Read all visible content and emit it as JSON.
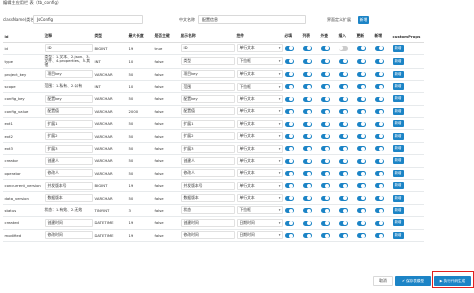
{
  "window": {
    "title": "编辑主应用栏 表（tb_config）"
  },
  "meta": {
    "class_label": "className(类名)",
    "class_value": "JsConfig",
    "cn_label": "中文名称",
    "cn_value": "配置信息",
    "ext_label": "界面定义扩展",
    "ext_button": "新增"
  },
  "table": {
    "headers": [
      "id",
      "注释",
      "类型",
      "最大长度",
      "是否主键",
      "显示名称",
      "控件",
      "必填",
      "列表",
      "外查",
      "插入",
      "更新",
      "新增",
      "customProps"
    ],
    "rows": [
      {
        "field": "id",
        "comment": "ID",
        "type": "BIGINT",
        "len": "19",
        "pk": "true",
        "label": "ID",
        "control": "单行文本",
        "t": [
          1,
          1,
          1,
          0,
          1,
          1
        ],
        "btn": "新增"
      },
      {
        "field": "type",
        "comment": "类型：1.文本、2.json、3.文件、4.properties、5.其他",
        "type": "INT",
        "len": "10",
        "pk": "false",
        "label": "类型",
        "control": "下拉框",
        "t": [
          1,
          1,
          1,
          1,
          1,
          1
        ],
        "btn": "新增"
      },
      {
        "field": "project_key",
        "comment": "项目key",
        "type": "VARCHAR",
        "len": "50",
        "pk": "false",
        "label": "项目key",
        "control": "单行文本",
        "t": [
          1,
          1,
          1,
          1,
          1,
          1
        ],
        "btn": "新增"
      },
      {
        "field": "scope",
        "comment": "范围：1.私有、2.公有",
        "type": "INT",
        "len": "10",
        "pk": "false",
        "label": "范围",
        "control": "下拉框",
        "t": [
          1,
          1,
          1,
          1,
          1,
          1
        ],
        "btn": "新增"
      },
      {
        "field": "config_key",
        "comment": "配置key",
        "type": "VARCHAR",
        "len": "50",
        "pk": "false",
        "label": "配置key",
        "control": "单行文本",
        "t": [
          1,
          1,
          1,
          1,
          1,
          1
        ],
        "btn": "新增"
      },
      {
        "field": "config_value",
        "comment": "配置值",
        "type": "VARCHAR",
        "len": "2000",
        "pk": "false",
        "label": "配置值",
        "control": "单行文本",
        "t": [
          1,
          1,
          1,
          1,
          1,
          1
        ],
        "btn": "新增"
      },
      {
        "field": "ext1",
        "comment": "扩展1",
        "type": "VARCHAR",
        "len": "50",
        "pk": "false",
        "label": "扩展1",
        "control": "单行文本",
        "t": [
          1,
          1,
          1,
          1,
          1,
          1
        ],
        "btn": "新增"
      },
      {
        "field": "ext2",
        "comment": "扩展2",
        "type": "VARCHAR",
        "len": "50",
        "pk": "false",
        "label": "扩展2",
        "control": "单行文本",
        "t": [
          1,
          1,
          1,
          1,
          1,
          1
        ],
        "btn": "新增"
      },
      {
        "field": "ext3",
        "comment": "扩展3",
        "type": "VARCHAR",
        "len": "50",
        "pk": "false",
        "label": "扩展3",
        "control": "单行文本",
        "t": [
          1,
          1,
          1,
          1,
          1,
          1
        ],
        "btn": "新增"
      },
      {
        "field": "creator",
        "comment": "创建人",
        "type": "VARCHAR",
        "len": "50",
        "pk": "false",
        "label": "创建人",
        "control": "单行文本",
        "t": [
          1,
          1,
          1,
          1,
          1,
          1
        ],
        "btn": "新增"
      },
      {
        "field": "operator",
        "comment": "修改人",
        "type": "VARCHAR",
        "len": "50",
        "pk": "false",
        "label": "修改人",
        "control": "单行文本",
        "t": [
          1,
          1,
          1,
          1,
          1,
          1
        ],
        "btn": "新增"
      },
      {
        "field": "concurrent_version",
        "comment": "并发版本号",
        "type": "BIGINT",
        "len": "19",
        "pk": "false",
        "label": "并发版本号",
        "control": "单行文本",
        "t": [
          1,
          1,
          1,
          1,
          1,
          1
        ],
        "btn": "新增"
      },
      {
        "field": "data_version",
        "comment": "数据版本",
        "type": "VARCHAR",
        "len": "50",
        "pk": "false",
        "label": "数据版本",
        "control": "单行文本",
        "t": [
          1,
          1,
          1,
          1,
          1,
          1
        ],
        "btn": "新增"
      },
      {
        "field": "status",
        "comment": "状态：1.有效、2.无效",
        "type": "TINYINT",
        "len": "3",
        "pk": "false",
        "label": "状态",
        "control": "下拉框",
        "t": [
          1,
          1,
          1,
          1,
          1,
          1
        ],
        "btn": "新增"
      },
      {
        "field": "created",
        "comment": "创建时间",
        "type": "DATETIME",
        "len": "19",
        "pk": "false",
        "label": "创建时间",
        "control": "日期时间",
        "t": [
          1,
          1,
          1,
          1,
          1,
          1
        ],
        "btn": "新增"
      },
      {
        "field": "modified",
        "comment": "修改时间",
        "type": "DATETIME",
        "len": "19",
        "pk": "false",
        "label": "修改时间",
        "control": "日期时间",
        "t": [
          1,
          1,
          1,
          1,
          1,
          1
        ],
        "btn": "新增"
      }
    ]
  },
  "footer": {
    "cancel": "取消",
    "save": "✔ 保存表模型",
    "exec": "▶ 执行代码生成"
  },
  "colors": {
    "accent": "#1c84c6",
    "highlight": "#e02020"
  }
}
